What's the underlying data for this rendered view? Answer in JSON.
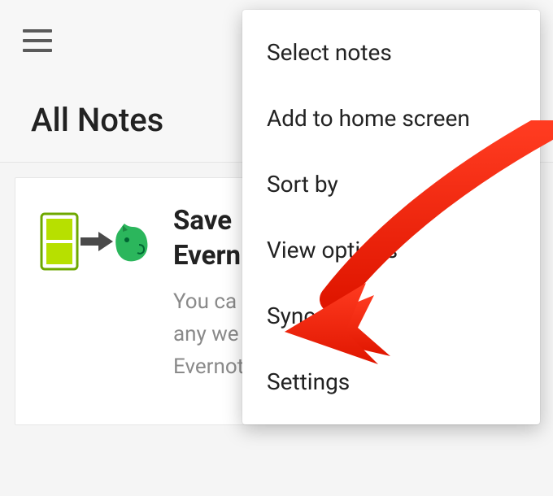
{
  "toolbar": {
    "menu_icon": "hamburger-icon"
  },
  "header": {
    "title": "All Notes"
  },
  "card": {
    "title_line1": "Save",
    "title_line2": "Evern",
    "text_line1": "You ca",
    "text_line2": "any we",
    "text_line3": "Evernot"
  },
  "menu": {
    "items": [
      "Select notes",
      "Add to home screen",
      "Sort by",
      "View options",
      "Sync",
      "Settings"
    ]
  },
  "annotation": {
    "target": "Sync"
  }
}
